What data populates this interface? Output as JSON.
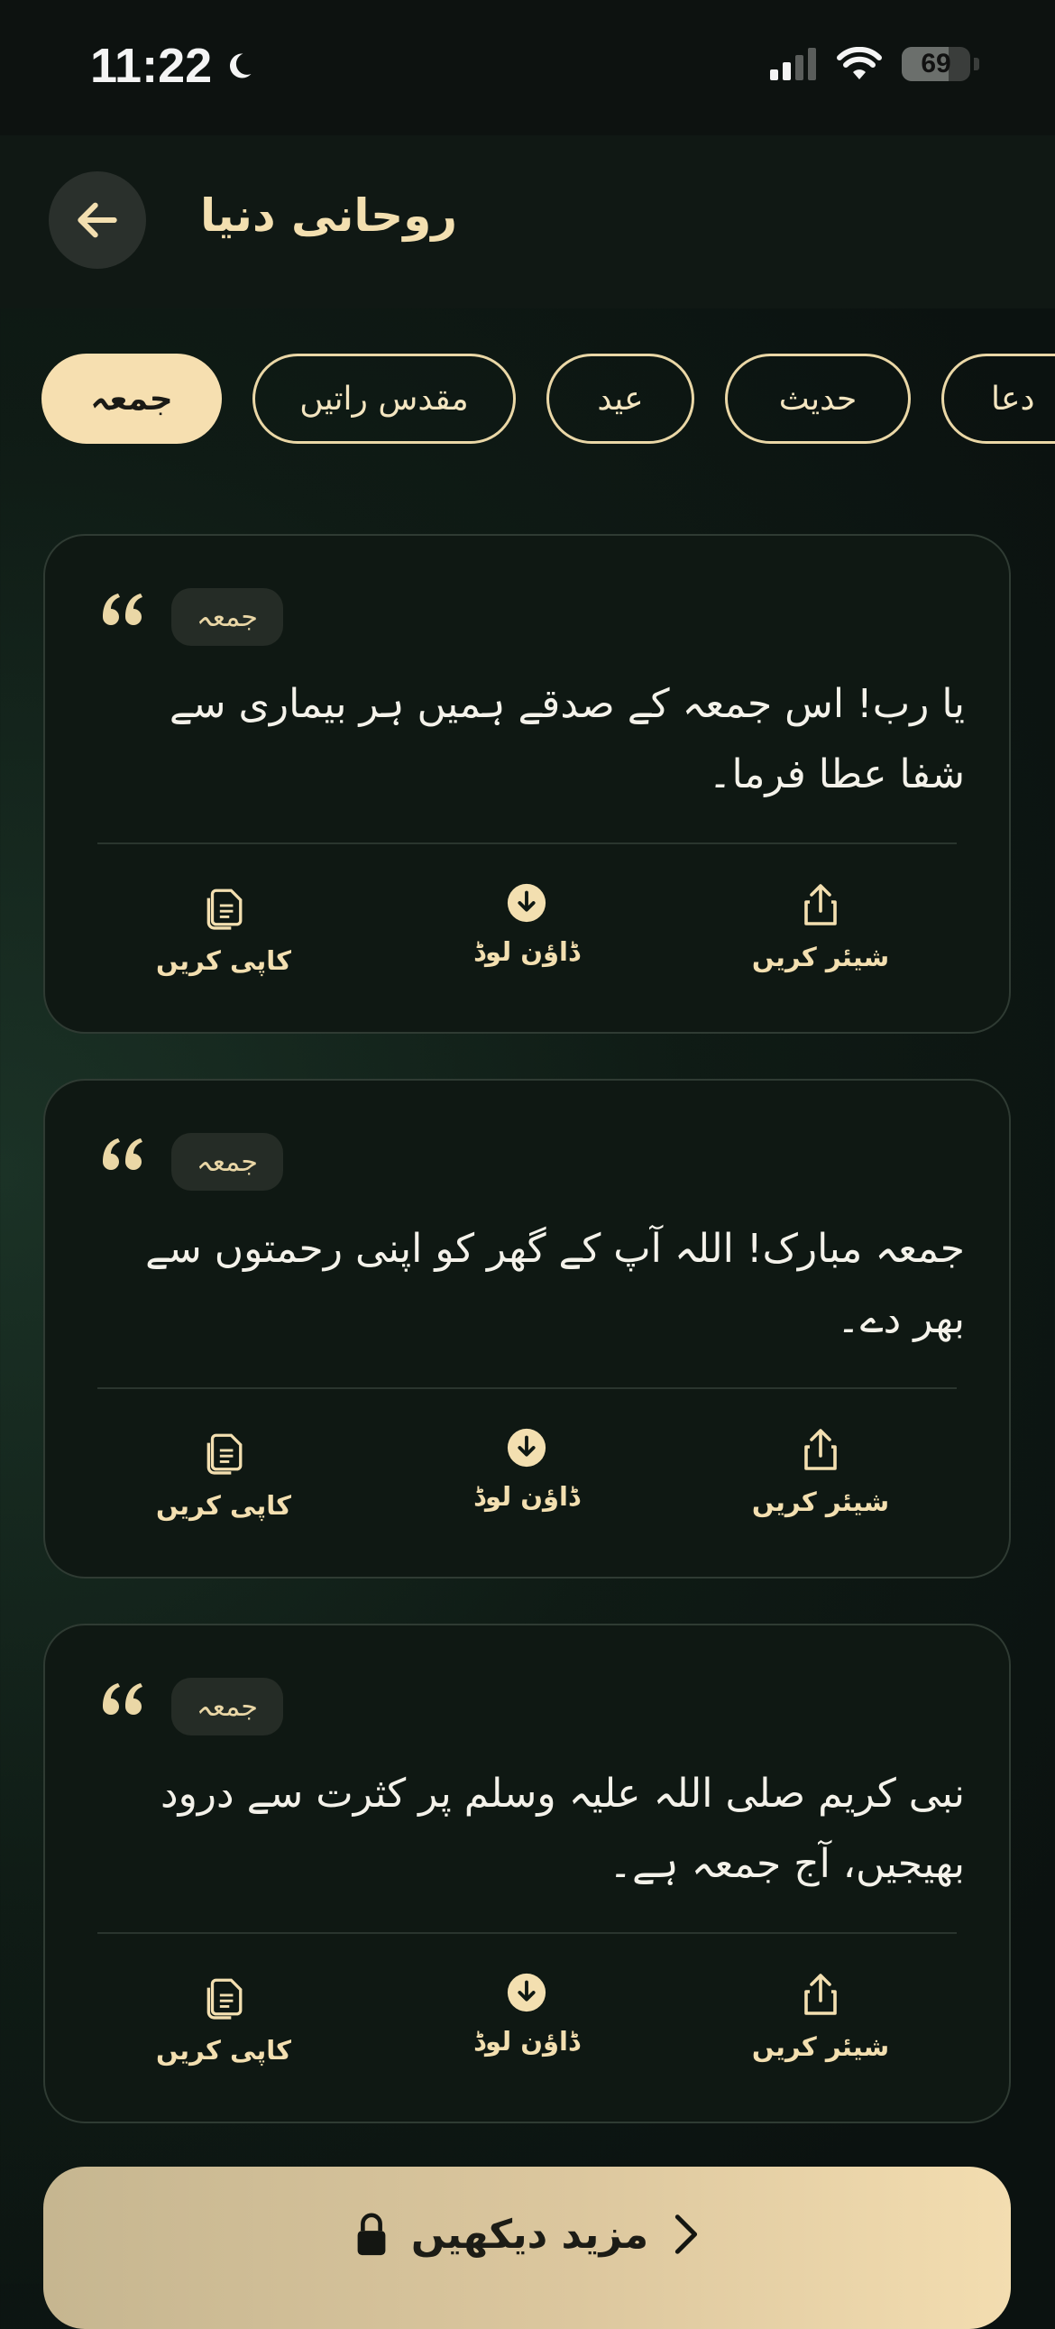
{
  "status_bar": {
    "time": "11:22",
    "battery": "69"
  },
  "header": {
    "title": "روحانی دنیا"
  },
  "categories": [
    {
      "label": "جمعہ",
      "active": true
    },
    {
      "label": "مقدس راتیں"
    },
    {
      "label": "عید"
    },
    {
      "label": "حدیث"
    },
    {
      "label": "دعا"
    }
  ],
  "cards": [
    {
      "tag": "جمعہ",
      "text": "یا رب! اس جمعہ کے صدقے ہمیں ہر بیماری سے شفا عطا فرما۔"
    },
    {
      "tag": "جمعہ",
      "text": "جمعہ مبارک! اللہ آپ کے گھر کو اپنی رحمتوں سے بھر دے۔"
    },
    {
      "tag": "جمعہ",
      "text": "نبی کریم صلی اللہ علیہ وسلم پر کثرت سے درود بھیجیں، آج جمعہ ہے۔"
    }
  ],
  "actions": {
    "copy": "کاپی کریں",
    "download": "ڈاؤن لوڈ",
    "share": "شیئر کریں"
  },
  "more_button": {
    "label": "مزید دیکھیں"
  },
  "colors": {
    "accent": "#f6dfb0",
    "card_bg": "#0f1813",
    "background": "#0f1b15"
  }
}
